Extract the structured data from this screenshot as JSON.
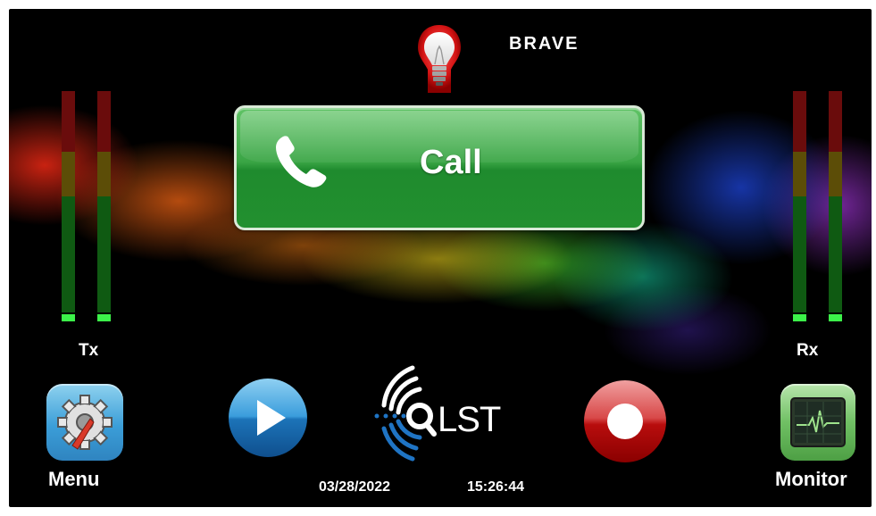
{
  "header": {
    "brand": "BRAVE",
    "status_icon": "lightbulb-icon"
  },
  "meters": {
    "tx_label": "Tx",
    "rx_label": "Rx",
    "colors": {
      "red": "#6a0c0c",
      "amber": "#5c4d07",
      "green": "#0f5a12",
      "active": "#3cf24a"
    }
  },
  "call_button": {
    "label": "Call",
    "icon": "phone-icon",
    "color": "#2e9a3c"
  },
  "toolbar": {
    "menu_label": "Menu",
    "menu_icon": "gear-icon",
    "play_icon": "play-icon",
    "record_icon": "record-icon",
    "monitor_label": "Monitor",
    "monitor_icon": "heartbeat-monitor-icon"
  },
  "logo": {
    "text": "LST",
    "icon": "signal-waves-icon"
  },
  "status": {
    "date": "03/28/2022",
    "time": "15:26:44"
  }
}
